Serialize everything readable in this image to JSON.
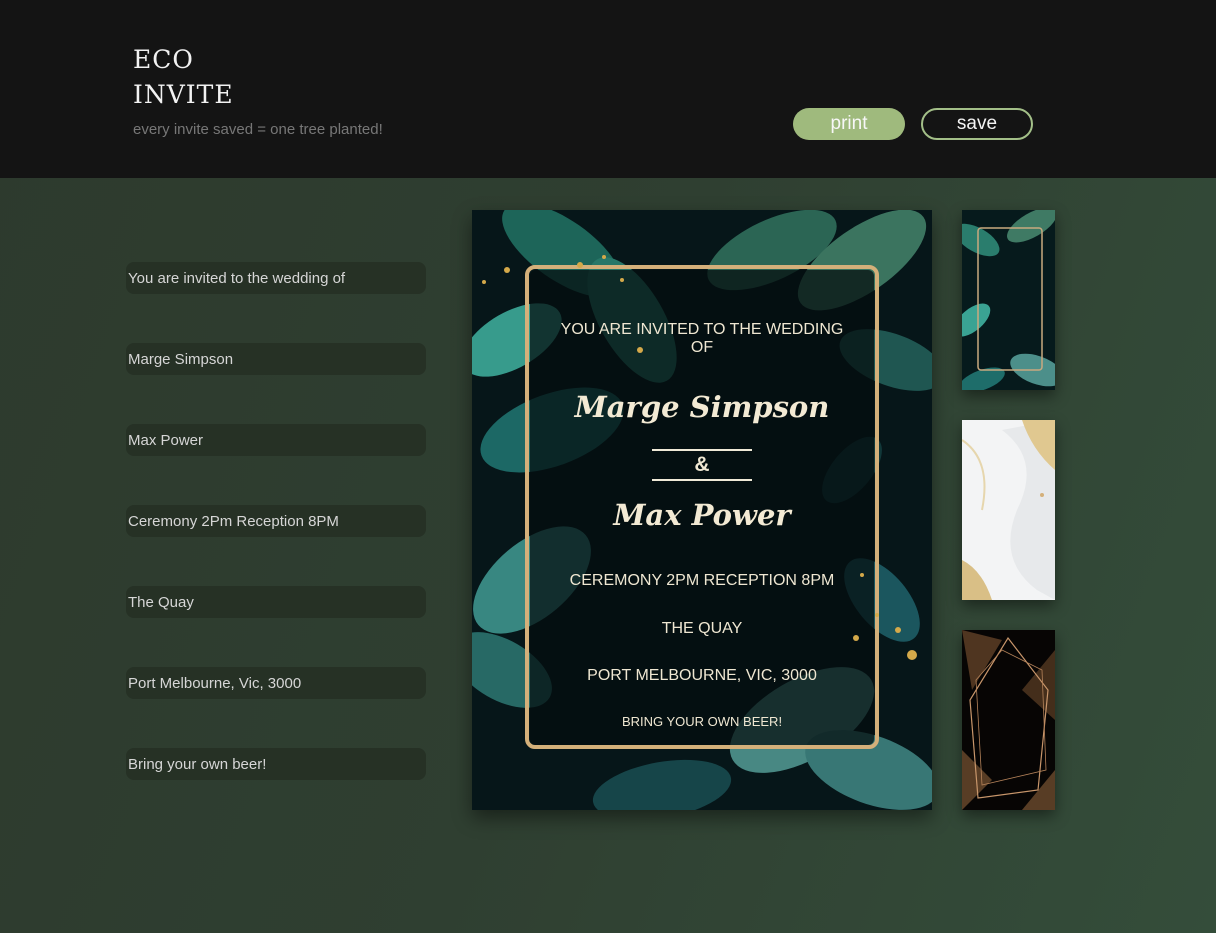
{
  "header": {
    "brand_line1": "ECO",
    "brand_line2": "INVITE",
    "tagline": "every invite saved = one tree planted!",
    "print_label": "print",
    "save_label": "save"
  },
  "form": {
    "invite_line": "You are invited to the wedding of",
    "partner1": "Marge Simpson",
    "partner2": "Max Power",
    "times": "Ceremony 2Pm Reception 8PM",
    "venue": "The Quay",
    "address": "Port Melbourne, Vic, 3000",
    "note": "Bring your own beer!"
  },
  "preview": {
    "invite_line": "YOU ARE INVITED TO THE WEDDING OF",
    "partner1": "Marge Simpson",
    "ampersand": "&",
    "partner2": "Max Power",
    "times": "CEREMONY 2PM RECEPTION 8PM",
    "venue": "THE QUAY",
    "address": "PORT MELBOURNE, VIC, 3000",
    "note": "BRING YOUR OWN BEER!"
  },
  "templates": [
    "green-leaves-gold-frame",
    "white-gold-palm",
    "black-gold-fern-geometric"
  ],
  "colors": {
    "accent": "#9fba7d",
    "header_bg": "#141414",
    "page_bg": "#2f3f31",
    "field_bg": "#263125",
    "gold": "#d4b07a"
  }
}
